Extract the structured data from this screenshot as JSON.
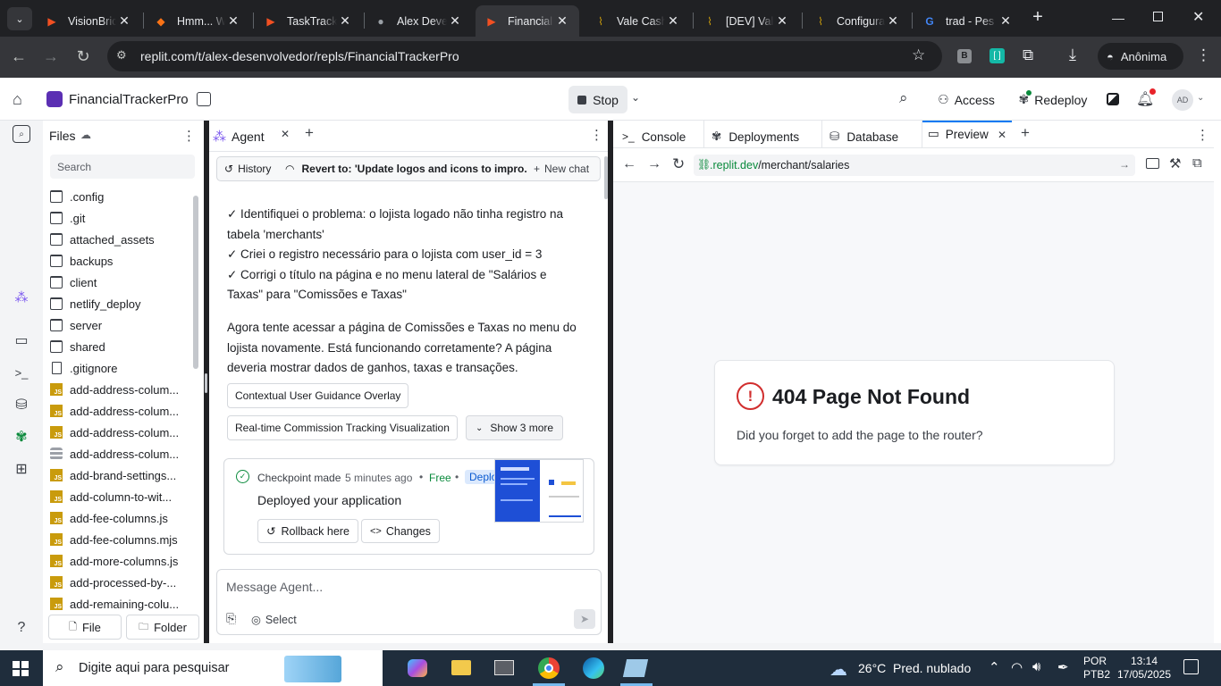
{
  "browser": {
    "tabs": [
      {
        "title": "VisionBric",
        "fav": "▶",
        "favColor": "#f25022"
      },
      {
        "title": "Hmm... W",
        "fav": "◆",
        "favColor": "#f97316"
      },
      {
        "title": "TaskTrack",
        "fav": "▶",
        "favColor": "#f25022"
      },
      {
        "title": "Alex Deve",
        "fav": "●",
        "favColor": "#9aa0a6"
      },
      {
        "title": "Financial T",
        "fav": "▶",
        "favColor": "#f25022"
      },
      {
        "title": "Vale Cash",
        "fav": "⌇",
        "favColor": "#c99b0c"
      },
      {
        "title": "[DEV] Vale",
        "fav": "⌇",
        "favColor": "#c99b0c"
      },
      {
        "title": "Configura",
        "fav": "⌇",
        "favColor": "#c99b0c"
      },
      {
        "title": "trad - Pes",
        "fav": "G",
        "favColor": "#4285f4"
      }
    ],
    "url": "replit.com/t/alex-desenvolvedor/repls/FinancialTrackerPro",
    "profile": "Anônima",
    "ext_b": "B"
  },
  "header": {
    "project": "FinancialTrackerPro",
    "stop": "Stop",
    "access": "Access",
    "redeploy": "Redeploy",
    "avatar": "AD"
  },
  "files": {
    "title": "Files",
    "search_placeholder": "Search",
    "items": [
      {
        "name": ".config",
        "type": "folder"
      },
      {
        "name": ".git",
        "type": "folder"
      },
      {
        "name": "attached_assets",
        "type": "folder"
      },
      {
        "name": "backups",
        "type": "folder"
      },
      {
        "name": "client",
        "type": "folder"
      },
      {
        "name": "netlify_deploy",
        "type": "folder"
      },
      {
        "name": "server",
        "type": "folder"
      },
      {
        "name": "shared",
        "type": "folder"
      },
      {
        "name": ".gitignore",
        "type": "file"
      },
      {
        "name": "add-address-colum...",
        "type": "js"
      },
      {
        "name": "add-address-colum...",
        "type": "js"
      },
      {
        "name": "add-address-colum...",
        "type": "js"
      },
      {
        "name": "add-address-colum...",
        "type": "db"
      },
      {
        "name": "add-brand-settings...",
        "type": "js"
      },
      {
        "name": "add-column-to-wit...",
        "type": "js"
      },
      {
        "name": "add-fee-columns.js",
        "type": "js"
      },
      {
        "name": "add-fee-columns.mjs",
        "type": "js"
      },
      {
        "name": "add-more-columns.js",
        "type": "js"
      },
      {
        "name": "add-processed-by-...",
        "type": "js"
      },
      {
        "name": "add-remaining-colu...",
        "type": "js"
      }
    ],
    "file_btn": "File",
    "folder_btn": "Folder"
  },
  "agent": {
    "tab": "Agent",
    "history": "History",
    "revert": "Revert to: 'Update logos and icons to impro...",
    "new_chat": "New chat",
    "msg_lines": [
      "✓ Identifiquei o problema: o lojista logado não tinha registro na",
      "tabela 'merchants'",
      "✓ Criei o registro necessário para o lojista com user_id = 3",
      "✓ Corrigi o título na página e no menu lateral de \"Salários e",
      "Taxas\" para \"Comissões e Taxas\""
    ],
    "msg2_lines": [
      "Agora tente acessar a página de Comissões e Taxas no menu do",
      "lojista novamente. Está funcionando corretamente? A página",
      "deveria mostrar dados de ganhos, taxas e transações."
    ],
    "suggestion1": "Contextual User Guidance Overlay",
    "suggestion2": "Real-time Commission Tracking Visualization",
    "show_more": "Show 3 more",
    "checkpoint_made": "Checkpoint made",
    "checkpoint_time": "5 minutes ago",
    "free": "Free",
    "deploy_tag": "Deploy",
    "deployed_text": "Deployed your application",
    "rollback": "Rollback here",
    "changes": "Changes",
    "input_placeholder": "Message Agent...",
    "select": "Select"
  },
  "preview": {
    "tabs": [
      "Console",
      "Deployments",
      "Database",
      "Preview"
    ],
    "url_host": ".replit.dev",
    "url_path": "/merchant/salaries",
    "error_title": "404 Page Not Found",
    "error_msg": "Did you forget to add the page to the router?"
  },
  "taskbar": {
    "search_placeholder": "Digite aqui para pesquisar",
    "weather": "26°C  Pred. nublado",
    "lang1": "POR",
    "lang2": "PTB2",
    "time": "13:14",
    "date": "17/05/2025"
  },
  "colors": {
    "accent": "#0079f2",
    "green": "#0a8a3c",
    "error": "#d12e2e"
  }
}
